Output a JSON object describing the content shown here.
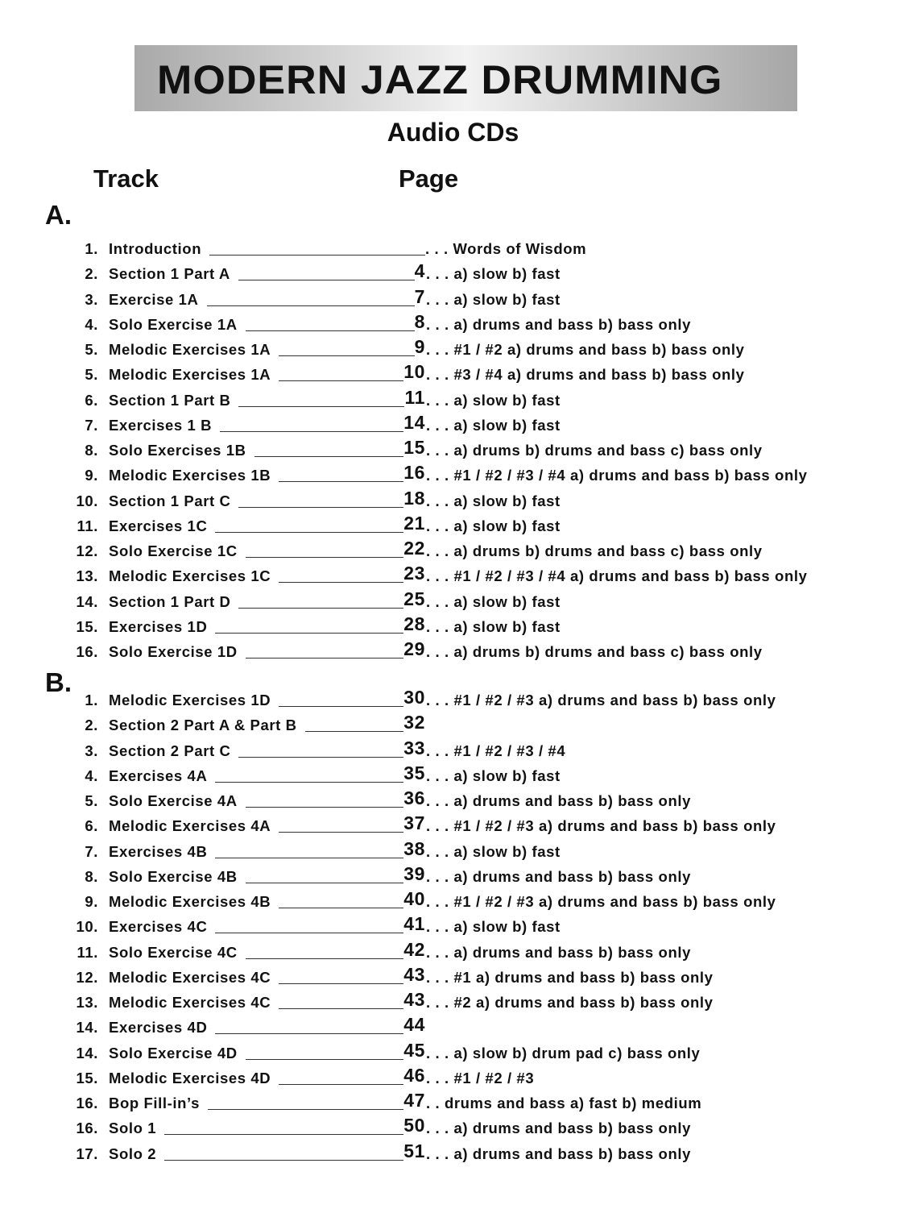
{
  "header": {
    "banner_title": "MODERN JAZZ DRUMMING",
    "subtitle": "Audio CDs",
    "col_track": "Track",
    "col_page": "Page"
  },
  "sections": [
    {
      "label": "A.",
      "tracks": [
        {
          "num": "1.",
          "title": "Introduction",
          "page": "",
          "desc": ". . . Words of Wisdom"
        },
        {
          "num": "2.",
          "title": "Section 1 Part A",
          "page": "4",
          "desc": ". . . a) slow b) fast"
        },
        {
          "num": "3.",
          "title": "Exercise 1A",
          "page": "7",
          "desc": ". . . a) slow b) fast"
        },
        {
          "num": "4.",
          "title": "Solo Exercise 1A",
          "page": "8",
          "desc": ". . . a) drums and bass b) bass only"
        },
        {
          "num": "5.",
          "title": "Melodic Exercises 1A",
          "page": "9",
          "desc": ". . . #1 / #2  a) drums and bass b) bass only"
        },
        {
          "num": "5.",
          "title": "Melodic Exercises 1A",
          "page": "10",
          "desc": ". . . #3 / #4  a) drums and bass b) bass only"
        },
        {
          "num": "6.",
          "title": "Section 1 Part B",
          "page": "11",
          "desc": ". . . a) slow b) fast"
        },
        {
          "num": "7.",
          "title": "Exercises 1 B",
          "page": "14",
          "desc": ". . . a) slow b) fast"
        },
        {
          "num": "8.",
          "title": "Solo Exercises 1B",
          "page": "15",
          "desc": ". . . a) drums b) drums and bass c) bass only"
        },
        {
          "num": "9.",
          "title": "Melodic Exercises 1B",
          "page": "16",
          "desc": ". . . #1 / #2 / #3 / #4  a) drums and bass b) bass only"
        },
        {
          "num": "10.",
          "title": "Section 1 Part C",
          "page": "18",
          "desc": ". . . a) slow b) fast"
        },
        {
          "num": "11.",
          "title": "Exercises 1C",
          "page": "21",
          "desc": ". . . a) slow b) fast"
        },
        {
          "num": "12.",
          "title": "Solo Exercise 1C",
          "page": "22",
          "desc": ". . . a) drums b) drums and bass c) bass only"
        },
        {
          "num": "13.",
          "title": "Melodic Exercises 1C",
          "page": "23",
          "desc": ". . . #1 / #2 / #3 / #4  a) drums and bass b) bass only"
        },
        {
          "num": "14.",
          "title": "Section 1 Part D",
          "page": "25",
          "desc": ". . . a) slow b) fast"
        },
        {
          "num": "15.",
          "title": "Exercises 1D",
          "page": "28",
          "desc": ". . . a) slow b) fast"
        },
        {
          "num": "16.",
          "title": "Solo Exercise 1D",
          "page": "29",
          "desc": ". . . a) drums b) drums and bass c) bass only"
        }
      ]
    },
    {
      "label": "B.",
      "tracks": [
        {
          "num": "1.",
          "title": "Melodic Exercises 1D",
          "page": "30",
          "desc": ". . . #1 / #2 / #3 a) drums and bass b) bass only"
        },
        {
          "num": "2.",
          "title": "Section 2 Part A & Part B",
          "page": "32",
          "desc": ""
        },
        {
          "num": "3.",
          "title": "Section 2 Part C",
          "page": "33",
          "desc": ". . . #1 / #2 / #3 / #4"
        },
        {
          "num": "4.",
          "title": "Exercises 4A",
          "page": "35",
          "desc": ". . . a) slow b) fast"
        },
        {
          "num": "5.",
          "title": "Solo Exercise 4A",
          "page": "36",
          "desc": ". . . a) drums and bass b) bass only"
        },
        {
          "num": "6.",
          "title": "Melodic Exercises 4A",
          "page": "37",
          "desc": ". . . #1 / #2 / #3 a) drums and bass b) bass only"
        },
        {
          "num": "7.",
          "title": "Exercises 4B",
          "page": "38",
          "desc": ". . . a) slow b) fast"
        },
        {
          "num": "8.",
          "title": "Solo Exercise 4B",
          "page": "39",
          "desc": ". . . a) drums and bass b) bass only"
        },
        {
          "num": "9.",
          "title": "Melodic Exercises 4B",
          "page": "40",
          "desc": ". . . #1 / #2 / #3 a) drums and bass b) bass only"
        },
        {
          "num": "10.",
          "title": "Exercises 4C",
          "page": "41",
          "desc": ". . . a) slow b) fast"
        },
        {
          "num": "11.",
          "title": "Solo Exercise 4C",
          "page": "42",
          "desc": ". . . a) drums and bass b) bass only"
        },
        {
          "num": "12.",
          "title": "Melodic Exercises 4C",
          "page": "43",
          "desc": ". . . #1  a) drums and bass b) bass only"
        },
        {
          "num": "13.",
          "title": "Melodic Exercises 4C",
          "page": "43",
          "desc": ". . . #2  a) drums and bass b) bass only"
        },
        {
          "num": "14.",
          "title": "Exercises 4D",
          "page": "44",
          "desc": ""
        },
        {
          "num": "14.",
          "title": "Solo Exercise 4D",
          "page": "45",
          "desc": ". . . a) slow b) drum pad c) bass only"
        },
        {
          "num": "15.",
          "title": "Melodic Exercises 4D",
          "page": "46",
          "desc": ". . . #1 / #2 / #3"
        },
        {
          "num": "16.",
          "title": "Bop Fill-in’s",
          "page": "47",
          "desc": ". . drums and bass a) fast b) medium"
        },
        {
          "num": "16.",
          "title": "Solo 1",
          "page": "50",
          "desc": ". . . a) drums and bass b) bass only"
        },
        {
          "num": "17.",
          "title": "Solo 2",
          "page": "51",
          "desc": ". . . a) drums and bass b) bass only"
        }
      ]
    }
  ]
}
